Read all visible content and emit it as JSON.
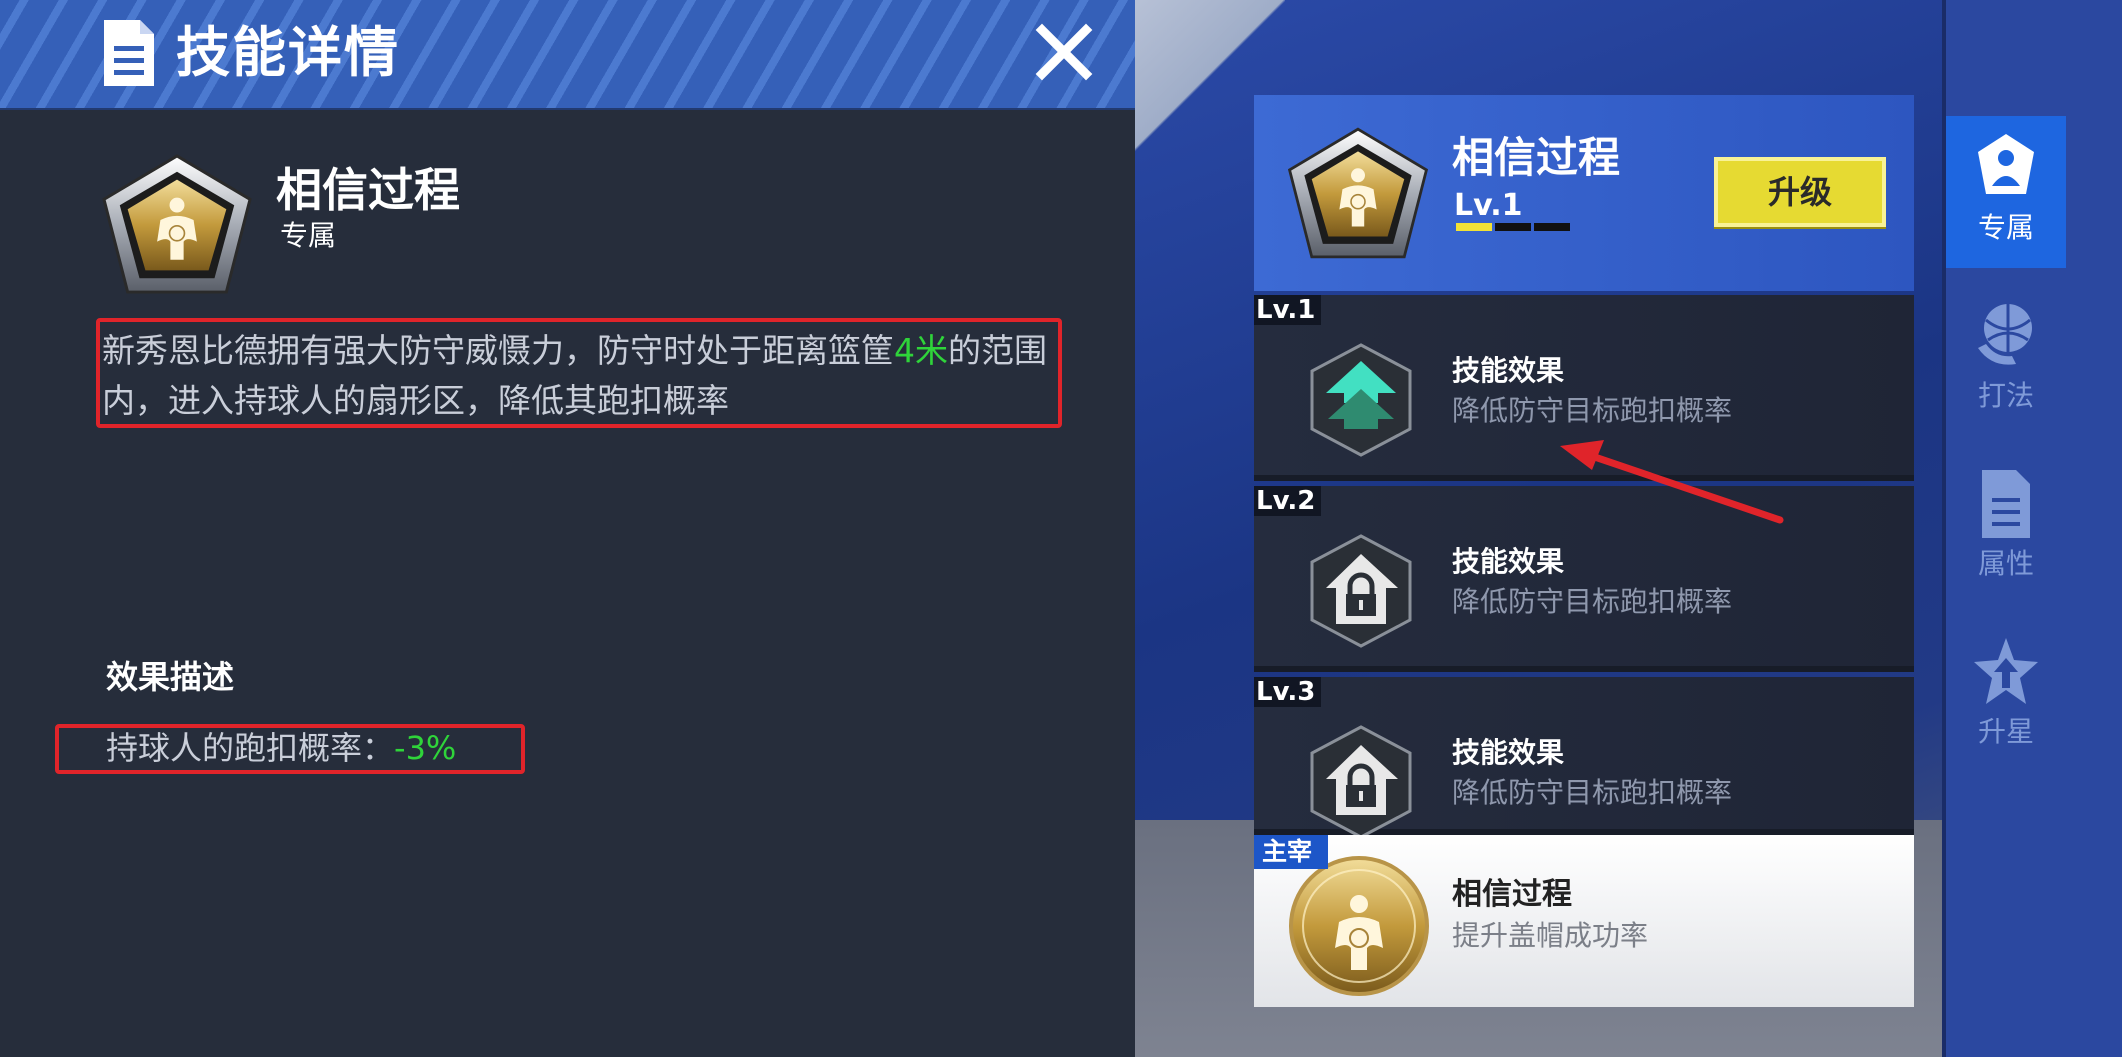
{
  "left_panel": {
    "title": "技能详情",
    "skill": {
      "name": "相信过程",
      "type": "专属"
    },
    "description": {
      "part1": "新秀恩比德拥有强大防守威慑力，防守时处于距离篮筐",
      "highlight": "4米",
      "part2": "的范围内，进入持球人的扇形区，降低其跑扣概率"
    },
    "effect_heading": "效果描述",
    "effect": {
      "label": "持球人的跑扣概率：",
      "value": "-3%"
    }
  },
  "skill_card": {
    "name": "相信过程",
    "level": "Lv.1",
    "upgrade_label": "升级",
    "levels": [
      {
        "tag": "Lv.1",
        "title": "技能效果",
        "desc": "降低防守目标跑扣概率",
        "locked": false
      },
      {
        "tag": "Lv.2",
        "title": "技能效果",
        "desc": "降低防守目标跑扣概率",
        "locked": true
      },
      {
        "tag": "Lv.3",
        "title": "技能效果",
        "desc": "降低防守目标跑扣概率",
        "locked": true
      }
    ],
    "master": {
      "tag": "主宰",
      "name": "相信过程",
      "desc": "提升盖帽成功率"
    }
  },
  "side_nav": [
    {
      "label": "专属",
      "icon": "player-shield-icon",
      "active": true
    },
    {
      "label": "打法",
      "icon": "basketball-hand-icon",
      "active": false
    },
    {
      "label": "属性",
      "icon": "document-icon",
      "active": false
    },
    {
      "label": "升星",
      "icon": "star-arrow-icon",
      "active": false
    }
  ],
  "colors": {
    "highlight_green": "#2fd43a",
    "annotation_red": "#e0242a",
    "upgrade_yellow": "#e6da32",
    "nav_active": "#1e66e0"
  }
}
